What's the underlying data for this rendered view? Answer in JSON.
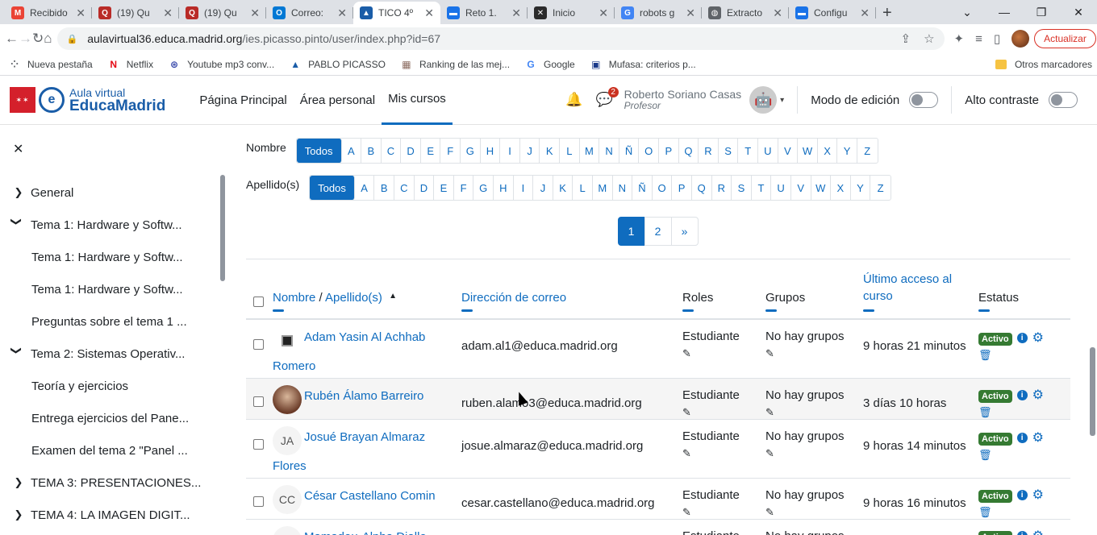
{
  "browser": {
    "tabs": [
      {
        "title": "Recibido",
        "icon": "gmail-icon",
        "color": "#ea4335",
        "glyph": "M"
      },
      {
        "title": "(19) Qu",
        "icon": "quora-icon",
        "color": "#b92b27",
        "glyph": "Q"
      },
      {
        "title": "(19) Qu",
        "icon": "quora-icon",
        "color": "#b92b27",
        "glyph": "Q"
      },
      {
        "title": "Correo:",
        "icon": "outlook-icon",
        "color": "#0078d4",
        "glyph": "O"
      },
      {
        "title": "TICO 4º",
        "icon": "moodle-cap-icon",
        "color": "#1a5da8",
        "glyph": "▲",
        "active": true
      },
      {
        "title": "Reto 1.",
        "icon": "docs-icon",
        "color": "#1a73e8",
        "glyph": "▬"
      },
      {
        "title": "Inicio",
        "icon": "app-icon",
        "color": "#2b2b2b",
        "glyph": "✕"
      },
      {
        "title": "robots g",
        "icon": "google-icon",
        "color": "#4285f4",
        "glyph": "G"
      },
      {
        "title": "Extracto",
        "icon": "globe-icon",
        "color": "#5f6368",
        "glyph": "◍"
      },
      {
        "title": "Configu",
        "icon": "docs-icon",
        "color": "#1a73e8",
        "glyph": "▬"
      }
    ],
    "url_host": "aulavirtual36.educa.madrid.org",
    "url_path": "/ies.picasso.pinto/user/index.php?id=67",
    "update_label": "Actualizar",
    "bookmarks": [
      {
        "label": "Nueva pestaña",
        "icon": "apps-grid-icon",
        "glyph": "⁘",
        "color": "#5f6368"
      },
      {
        "label": "Netflix",
        "icon": "netflix-icon",
        "glyph": "N",
        "color": "#e50914"
      },
      {
        "label": "Youtube mp3 conv...",
        "icon": "converter-icon",
        "glyph": "⊛",
        "color": "#3949ab"
      },
      {
        "label": "PABLO PICASSO",
        "icon": "moodle-cap-icon",
        "glyph": "▲",
        "color": "#1a5da8"
      },
      {
        "label": "Ranking de las mej...",
        "icon": "page-icon",
        "glyph": "▦",
        "color": "#8d6e63"
      },
      {
        "label": "Google",
        "icon": "google-icon",
        "glyph": "G",
        "color": "#4285f4"
      },
      {
        "label": "Mufasa: criterios p...",
        "icon": "bookmark-doc-icon",
        "glyph": "▣",
        "color": "#1a3a8a"
      }
    ],
    "other_bookmarks": "Otros marcadores"
  },
  "moodle": {
    "logo_line1": "Aula virtual",
    "logo_line2": "EducaMadrid",
    "nav": [
      "Página Principal",
      "Área personal",
      "Mis cursos"
    ],
    "messages_badge": "2",
    "user_name": "Roberto Soriano Casas",
    "user_role": "Profesor",
    "edit_mode_label": "Modo de edición",
    "contrast_label": "Alto contraste"
  },
  "drawer": {
    "items": [
      {
        "label": "General",
        "type": "collapsed"
      },
      {
        "label": "Tema 1: Hardware y Softw...",
        "type": "expanded"
      },
      {
        "label": "Tema 1: Hardware y Softw...",
        "type": "sub"
      },
      {
        "label": "Tema 1: Hardware y Softw...",
        "type": "sub"
      },
      {
        "label": "Preguntas sobre el tema 1 ...",
        "type": "sub"
      },
      {
        "label": "Tema 2: Sistemas Operativ...",
        "type": "expanded"
      },
      {
        "label": "Teoría y ejercicios",
        "type": "sub"
      },
      {
        "label": "Entrega ejercicios del Pane...",
        "type": "sub"
      },
      {
        "label": "Examen del tema 2 \"Panel ...",
        "type": "sub"
      },
      {
        "label": "TEMA 3: PRESENTACIONES...",
        "type": "collapsed"
      },
      {
        "label": "TEMA 4: LA IMAGEN DIGIT...",
        "type": "collapsed"
      }
    ]
  },
  "filters": {
    "first_label": "Nombre",
    "last_label": "Apellido(s)",
    "all": "Todos",
    "letters": [
      "A",
      "B",
      "C",
      "D",
      "E",
      "F",
      "G",
      "H",
      "I",
      "J",
      "K",
      "L",
      "M",
      "N",
      "Ñ",
      "O",
      "P",
      "Q",
      "R",
      "S",
      "T",
      "U",
      "V",
      "W",
      "X",
      "Y",
      "Z"
    ]
  },
  "pagination": {
    "pages": [
      "1",
      "2"
    ],
    "next": "»"
  },
  "table": {
    "headers": {
      "name": "Nombre",
      "sep": " / ",
      "surname": "Apellido(s)",
      "email": "Dirección de correo",
      "roles": "Roles",
      "groups": "Grupos",
      "last_access": "Último acceso al curso",
      "status": "Estatus"
    },
    "rows": [
      {
        "first": "Adam Yasin Al Achhab",
        "rest": "Romero",
        "avatar": "pix",
        "initials": "",
        "email": "adam.al1@educa.madrid.org",
        "role": "Estudiante",
        "groups": "No hay grupos",
        "last": "9 horas 21 minutos",
        "status": "Activo"
      },
      {
        "first": "Rubén Álamo Barreiro",
        "rest": "",
        "avatar": "img",
        "initials": "",
        "email": "ruben.alamo3@educa.madrid.org",
        "role": "Estudiante",
        "groups": "No hay grupos",
        "last": "3 días 10 horas",
        "status": "Activo"
      },
      {
        "first": "Josué Brayan Almaraz",
        "rest": "Flores",
        "avatar": "initials",
        "initials": "JA",
        "email": "josue.almaraz@educa.madrid.org",
        "role": "Estudiante",
        "groups": "No hay grupos",
        "last": "9 horas 14 minutos",
        "status": "Activo"
      },
      {
        "first": "César Castellano Comin",
        "rest": "",
        "avatar": "initials",
        "initials": "CC",
        "email": "cesar.castellano@educa.madrid.org",
        "role": "Estudiante",
        "groups": "No hay grupos",
        "last": "9 horas 16 minutos",
        "status": "Activo"
      },
      {
        "first": "Mamadou-Alpha Diallo",
        "rest": "",
        "avatar": "initials",
        "initials": "MD",
        "email": "",
        "role": "Estudiante",
        "groups": "No hay grupos",
        "last": "",
        "status": "Activo"
      }
    ]
  }
}
